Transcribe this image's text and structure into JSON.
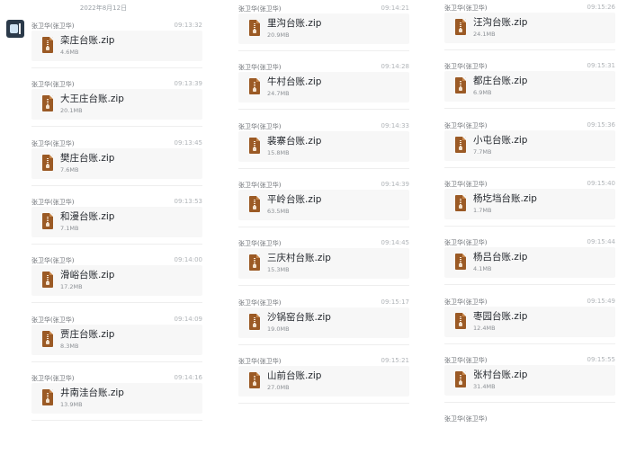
{
  "date_separator": "2022年8月12日",
  "sender": "张卫华(张卫华)",
  "columns": [
    {
      "messages": [
        {
          "time": "09:13:32",
          "file": "栾庄台账.zip",
          "size": "4.6MB"
        },
        {
          "time": "09:13:39",
          "file": "大王庄台账.zip",
          "size": "20.1MB"
        },
        {
          "time": "09:13:45",
          "file": "樊庄台账.zip",
          "size": "7.6MB"
        },
        {
          "time": "09:13:53",
          "file": "和漫台账.zip",
          "size": "7.1MB"
        },
        {
          "time": "09:14:00",
          "file": "滑峪台账.zip",
          "size": "17.2MB"
        },
        {
          "time": "09:14:09",
          "file": "贾庄台账.zip",
          "size": "8.3MB"
        },
        {
          "time": "09:14:16",
          "file": "井南洼台账.zip",
          "size": "13.9MB"
        }
      ]
    },
    {
      "messages": [
        {
          "time": "09:14:21",
          "file": "里沟台账.zip",
          "size": "20.9MB"
        },
        {
          "time": "09:14:28",
          "file": "牛村台账.zip",
          "size": "24.7MB"
        },
        {
          "time": "09:14:33",
          "file": "裴寨台账.zip",
          "size": "15.8MB"
        },
        {
          "time": "09:14:39",
          "file": "平岭台账.zip",
          "size": "63.5MB"
        },
        {
          "time": "09:14:45",
          "file": "三庆村台账.zip",
          "size": "15.3MB"
        },
        {
          "time": "09:15:17",
          "file": "沙锅窑台账.zip",
          "size": "19.0MB"
        },
        {
          "time": "09:15:21",
          "file": "山前台账.zip",
          "size": "27.0MB"
        }
      ]
    },
    {
      "messages": [
        {
          "time": "09:15:26",
          "file": "汪沟台账.zip",
          "size": "24.1MB"
        },
        {
          "time": "09:15:31",
          "file": "都庄台账.zip",
          "size": "6.9MB"
        },
        {
          "time": "09:15:36",
          "file": "小屯台账.zip",
          "size": "7.7MB"
        },
        {
          "time": "09:15:40",
          "file": "杨圪垱台账.zip",
          "size": "1.7MB"
        },
        {
          "time": "09:15:44",
          "file": "杨吕台账.zip",
          "size": "4.1MB"
        },
        {
          "time": "09:15:49",
          "file": "枣园台账.zip",
          "size": "12.4MB"
        },
        {
          "time": "09:15:55",
          "file": "张村台账.zip",
          "size": "31.4MB"
        }
      ],
      "trailing_sender": "张卫华(张卫华)"
    }
  ]
}
